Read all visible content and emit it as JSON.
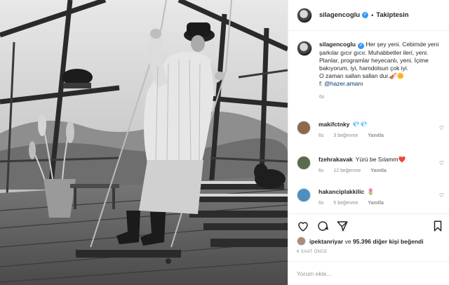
{
  "post": {
    "username": "silagencoglu",
    "follow_label": "Takiptesin",
    "separator": "•",
    "caption": {
      "username": "silagencoglu",
      "text": "Her şey yeni. Cebimde yeni şarkılar gıcır gıcır. Muhabbetler ileri, yeni. Planlar, programlar heyecanlı, yeni. İçime bakıyorum, iyi, hamdolsun çok iyi.",
      "line2_prefix": "O zaman sallan sallan dur.",
      "line2_emoji": "🎻🌼",
      "credit_prefix": "f: ",
      "credit_mention": "@hazer.amanı",
      "time": "6s"
    },
    "comments": [
      {
        "username": "makifctnky",
        "text": "💎💎",
        "time": "6s",
        "likes": "3 beğenme",
        "reply": "Yanıtla",
        "avatar_color": "#8a6a52"
      },
      {
        "username": "fzehrakavak",
        "text": "Yürü be Sılamm❤️",
        "time": "6s",
        "likes": "12 beğenme",
        "reply": "Yanıtla",
        "avatar_color": "#5a6a4a"
      },
      {
        "username": "hakanciplakkilic",
        "text": "🌷",
        "time": "6s",
        "likes": "5 beğenme",
        "reply": "Yanıtla",
        "avatar_color": "#4a90c0"
      }
    ],
    "liked_by": {
      "user": "ipektanriyar",
      "conjunction": "ve",
      "count": "95.396",
      "suffix": "diğer kişi beğendi"
    },
    "date": "6 SAAT ÖNCE",
    "comment_input": {
      "placeholder": "Yorum ekle..."
    },
    "icons": {
      "like": "heart-icon",
      "comment": "comment-icon",
      "share": "share-icon",
      "save": "bookmark-icon",
      "verified": "verified-badge-icon"
    },
    "colors": {
      "verified": "#3897f0",
      "meta_text": "#8e8e8e",
      "mention": "#003569"
    }
  }
}
